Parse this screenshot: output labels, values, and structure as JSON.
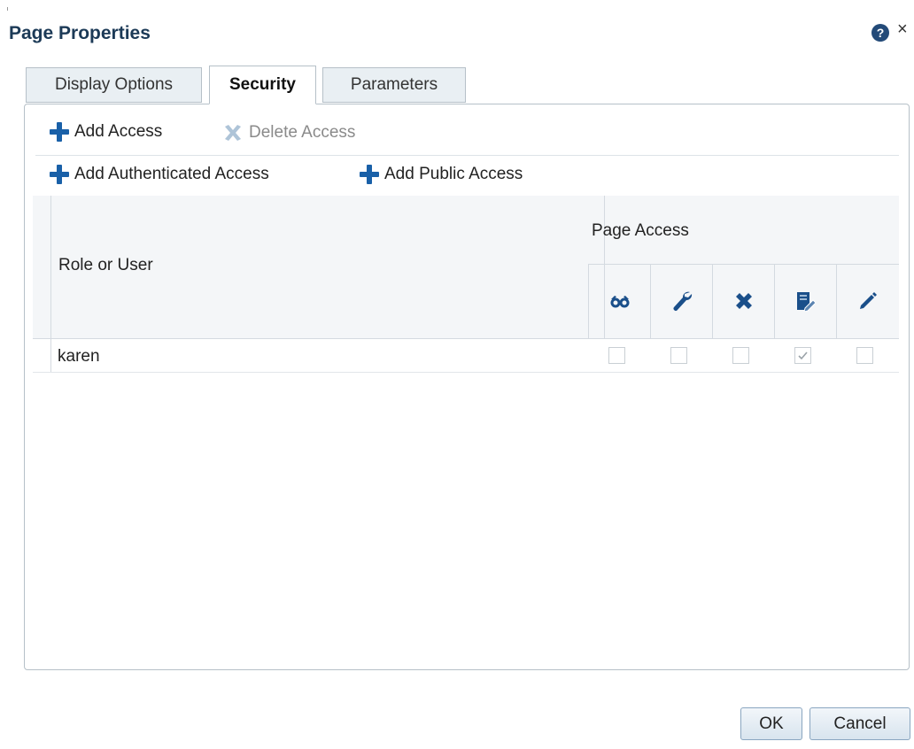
{
  "dialog": {
    "title": "Page Properties",
    "help_glyph": "?",
    "close_glyph": "×"
  },
  "tabs": [
    {
      "label": "Display Options",
      "active": false
    },
    {
      "label": "Security",
      "active": true
    },
    {
      "label": "Parameters",
      "active": false
    }
  ],
  "toolbar": {
    "add_access": "Add Access",
    "delete_access": "Delete Access",
    "add_authenticated_access": "Add Authenticated Access",
    "add_public_access": "Add Public Access"
  },
  "table": {
    "col_role_or_user": "Role or User",
    "col_page_access": "Page Access",
    "permission_icons": [
      "view-icon",
      "customize-icon",
      "delete-icon",
      "personalize-icon",
      "edit-icon"
    ],
    "rows": [
      {
        "name": "karen",
        "permissions": [
          false,
          false,
          false,
          true,
          false
        ]
      }
    ]
  },
  "buttons": {
    "ok": "OK",
    "cancel": "Cancel"
  },
  "colors": {
    "accent": "#1960a8",
    "title": "#1c3a57",
    "icon_dark": "#1a4f8a"
  }
}
